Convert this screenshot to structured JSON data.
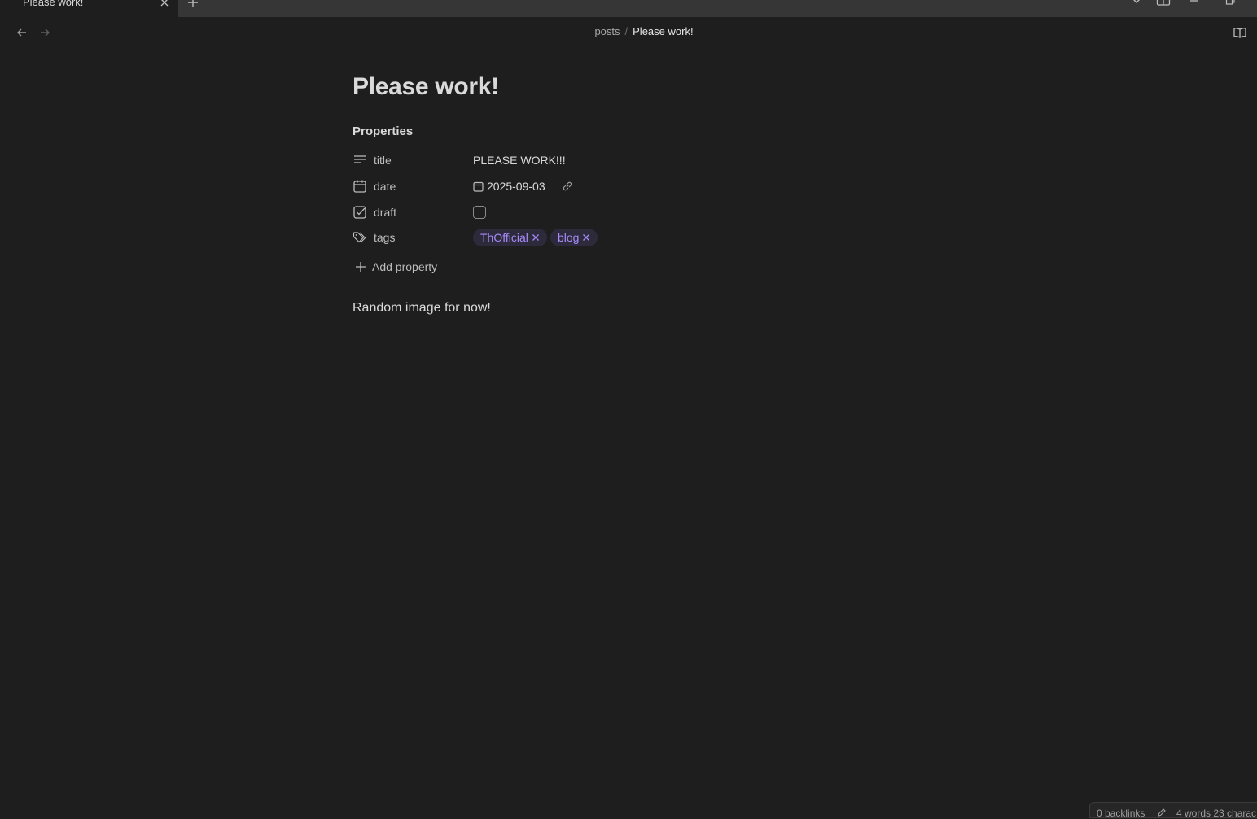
{
  "tab": {
    "title": "Please work!"
  },
  "breadcrumb": {
    "folder": "posts",
    "separator": "/",
    "file": "Please work!"
  },
  "note": {
    "title": "Please work!",
    "properties_heading": "Properties",
    "properties": [
      {
        "key": "title",
        "icon": "text-lines-icon",
        "value": "PLEASE WORK!!!"
      },
      {
        "key": "date",
        "icon": "calendar-icon",
        "value": "2025-09-03"
      },
      {
        "key": "draft",
        "icon": "checkbox-icon",
        "checked": false
      },
      {
        "key": "tags",
        "icon": "tags-icon",
        "tags": [
          "ThOfficial",
          "blog"
        ]
      }
    ],
    "add_property_label": "Add property",
    "body": "Random image for now!"
  },
  "status": {
    "backlinks": "0 backlinks",
    "counts": "4 words 23 charac"
  },
  "colors": {
    "background": "#1e1e1e",
    "tab_strip": "#363636",
    "tag_text": "#a88bfa",
    "tag_bg": "#2d2a3b"
  }
}
